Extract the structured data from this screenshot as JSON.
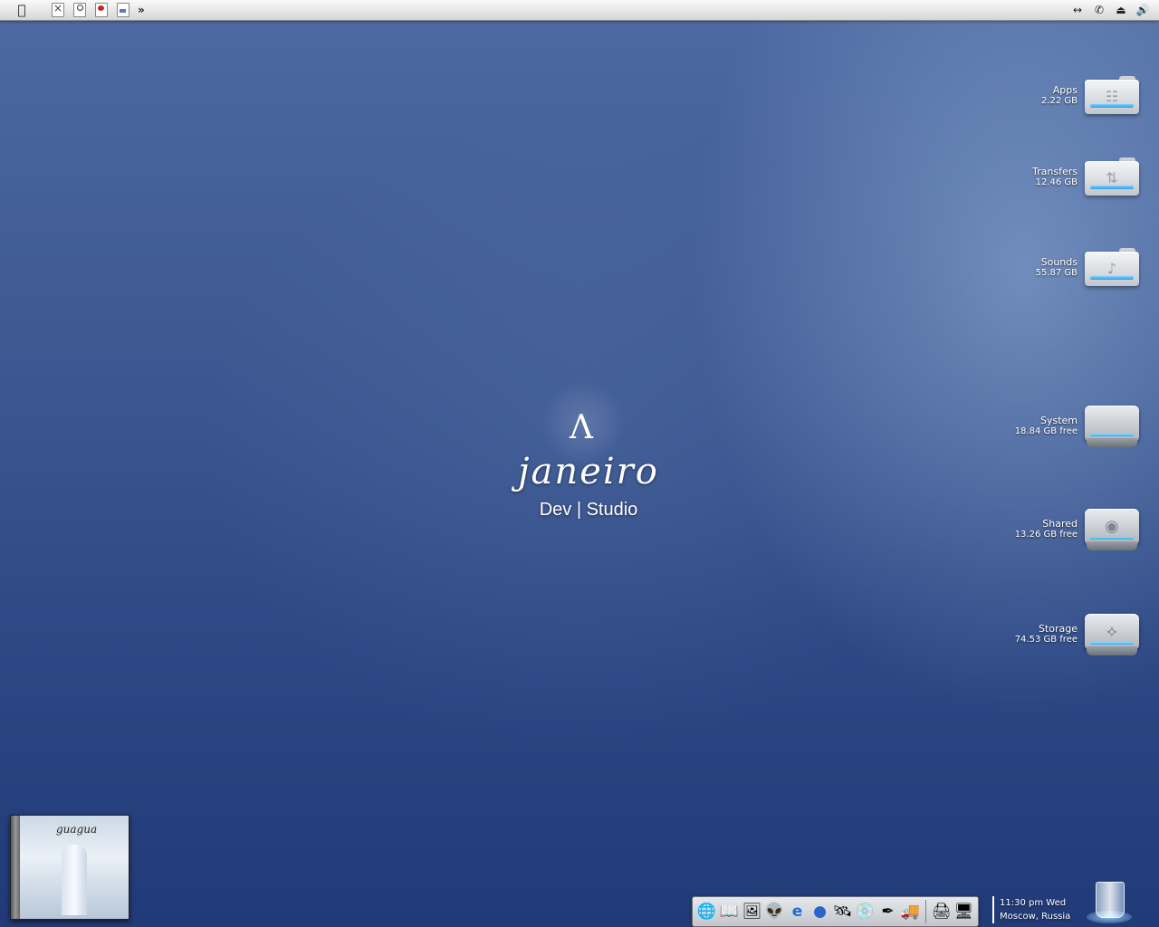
{
  "menubar": {
    "apple_icon": "apple-icon",
    "left_icons": [
      "x-doc-icon",
      "pin-doc-icon",
      "flower-doc-icon",
      "blue-doc-icon"
    ],
    "more_label": "»",
    "right_icons": [
      "network-icon",
      "phone-icon",
      "eject-icon",
      "volume-icon"
    ]
  },
  "drives": [
    {
      "name": "Apps",
      "size": "2.22 GB",
      "kind": "folder"
    },
    {
      "name": "Transfers",
      "size": "12.46 GB",
      "kind": "folder"
    },
    {
      "name": "Sounds",
      "size": "55.87 GB",
      "kind": "folder"
    },
    {
      "name": "System",
      "size": "18.84 GB free",
      "kind": "disk"
    },
    {
      "name": "Shared",
      "size": "13.26 GB free",
      "kind": "disk"
    },
    {
      "name": "Storage",
      "size": "74.53 GB free",
      "kind": "disk"
    }
  ],
  "logo": {
    "wordmark": "janeiro",
    "dev": "Dev",
    "divider": "|",
    "studio": "Studio"
  },
  "cd_cover": {
    "title": "guagua"
  },
  "dock": {
    "items": [
      "globe-icon",
      "book-icon",
      "picture-icon",
      "alien-icon",
      "ie-icon",
      "blue-ball-icon",
      "satellite-icon",
      "cd-icon",
      "pen-icon",
      "truck-icon",
      "printer-icon",
      "finder-icon"
    ]
  },
  "clock": {
    "time": "11:30 pm Wed",
    "location": "Moscow, Russia"
  },
  "colors": {
    "accent": "#2f9fe8",
    "desktop": "#2f4a86"
  }
}
